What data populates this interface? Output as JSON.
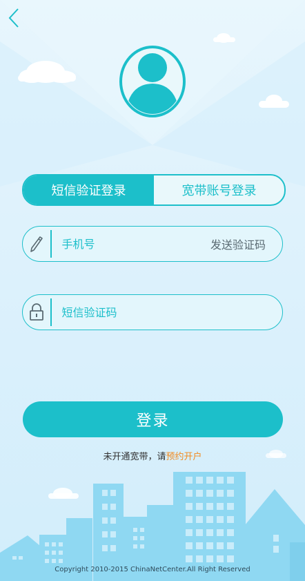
{
  "tabs": [
    {
      "label": "短信验证登录",
      "active": true
    },
    {
      "label": "宽带账号登录",
      "active": false
    }
  ],
  "phone_field": {
    "placeholder": "手机号",
    "value": ""
  },
  "send_code_label": "发送验证码",
  "sms_field": {
    "placeholder": "短信验证码",
    "value": ""
  },
  "login_label": "登录",
  "hint": {
    "text": "未开通宽带，请",
    "link": "预约开户"
  },
  "copyright": "Copyright 2010-2015 ChinaNetCenter.All Right Reserved",
  "icons": {
    "back": "chevron-left-icon",
    "avatar": "user-avatar-icon",
    "phone": "pencil-icon",
    "sms": "lock-icon"
  },
  "colors": {
    "accent": "#1cbfca",
    "link": "#f28a1e",
    "background": "#dff2fc"
  }
}
